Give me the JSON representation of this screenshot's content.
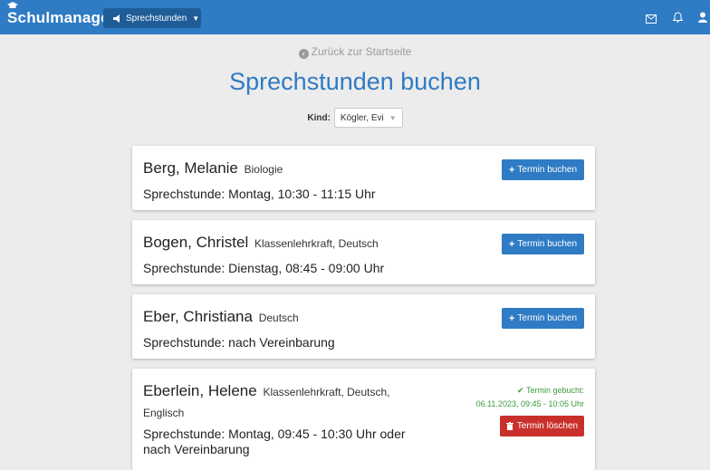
{
  "navbar": {
    "brand": "Schulmanager",
    "menu_label": "Sprechstunden",
    "icons": [
      "graduation-cap-icon",
      "megaphone-icon",
      "mail-icon",
      "bell-icon",
      "user-icon"
    ]
  },
  "back_link": "Zurück zur Startseite",
  "page_title": "Sprechstunden buchen",
  "child": {
    "label": "Kind:",
    "selected": "Kögler, Evi"
  },
  "teachers": [
    {
      "name": "Berg, Melanie",
      "subjects": "Biologie",
      "hours": "Sprechstunde: Montag, 10:30 - 11:15 Uhr",
      "button": "Termin buchen"
    },
    {
      "name": "Bogen, Christel",
      "subjects": "Klassenlehrkraft, Deutsch",
      "hours": "Sprechstunde: Dienstag, 08:45 - 09:00 Uhr",
      "button": "Termin buchen"
    },
    {
      "name": "Eber, Christiana",
      "subjects": "Deutsch",
      "hours": "Sprechstunde: nach Vereinbarung",
      "button": "Termin buchen"
    },
    {
      "name": "Eberlein, Helene",
      "subjects": "Klassenlehrkraft, Deutsch,",
      "subjects_line2": "Englisch",
      "hours": "Sprechstunde: Montag, 09:45 - 10:30 Uhr oder",
      "hours_line2": "nach Vereinbarung",
      "booked_label": "Termin gebucht:",
      "booked_time": "06.11.2023, 09:45 - 10:05 Uhr",
      "button": "Termin löschen"
    }
  ],
  "colors": {
    "primary": "#2f7bc4",
    "navbar": "#2f7bc4",
    "danger": "#c9302c",
    "success": "#3c9a3c",
    "background": "#ececec"
  }
}
